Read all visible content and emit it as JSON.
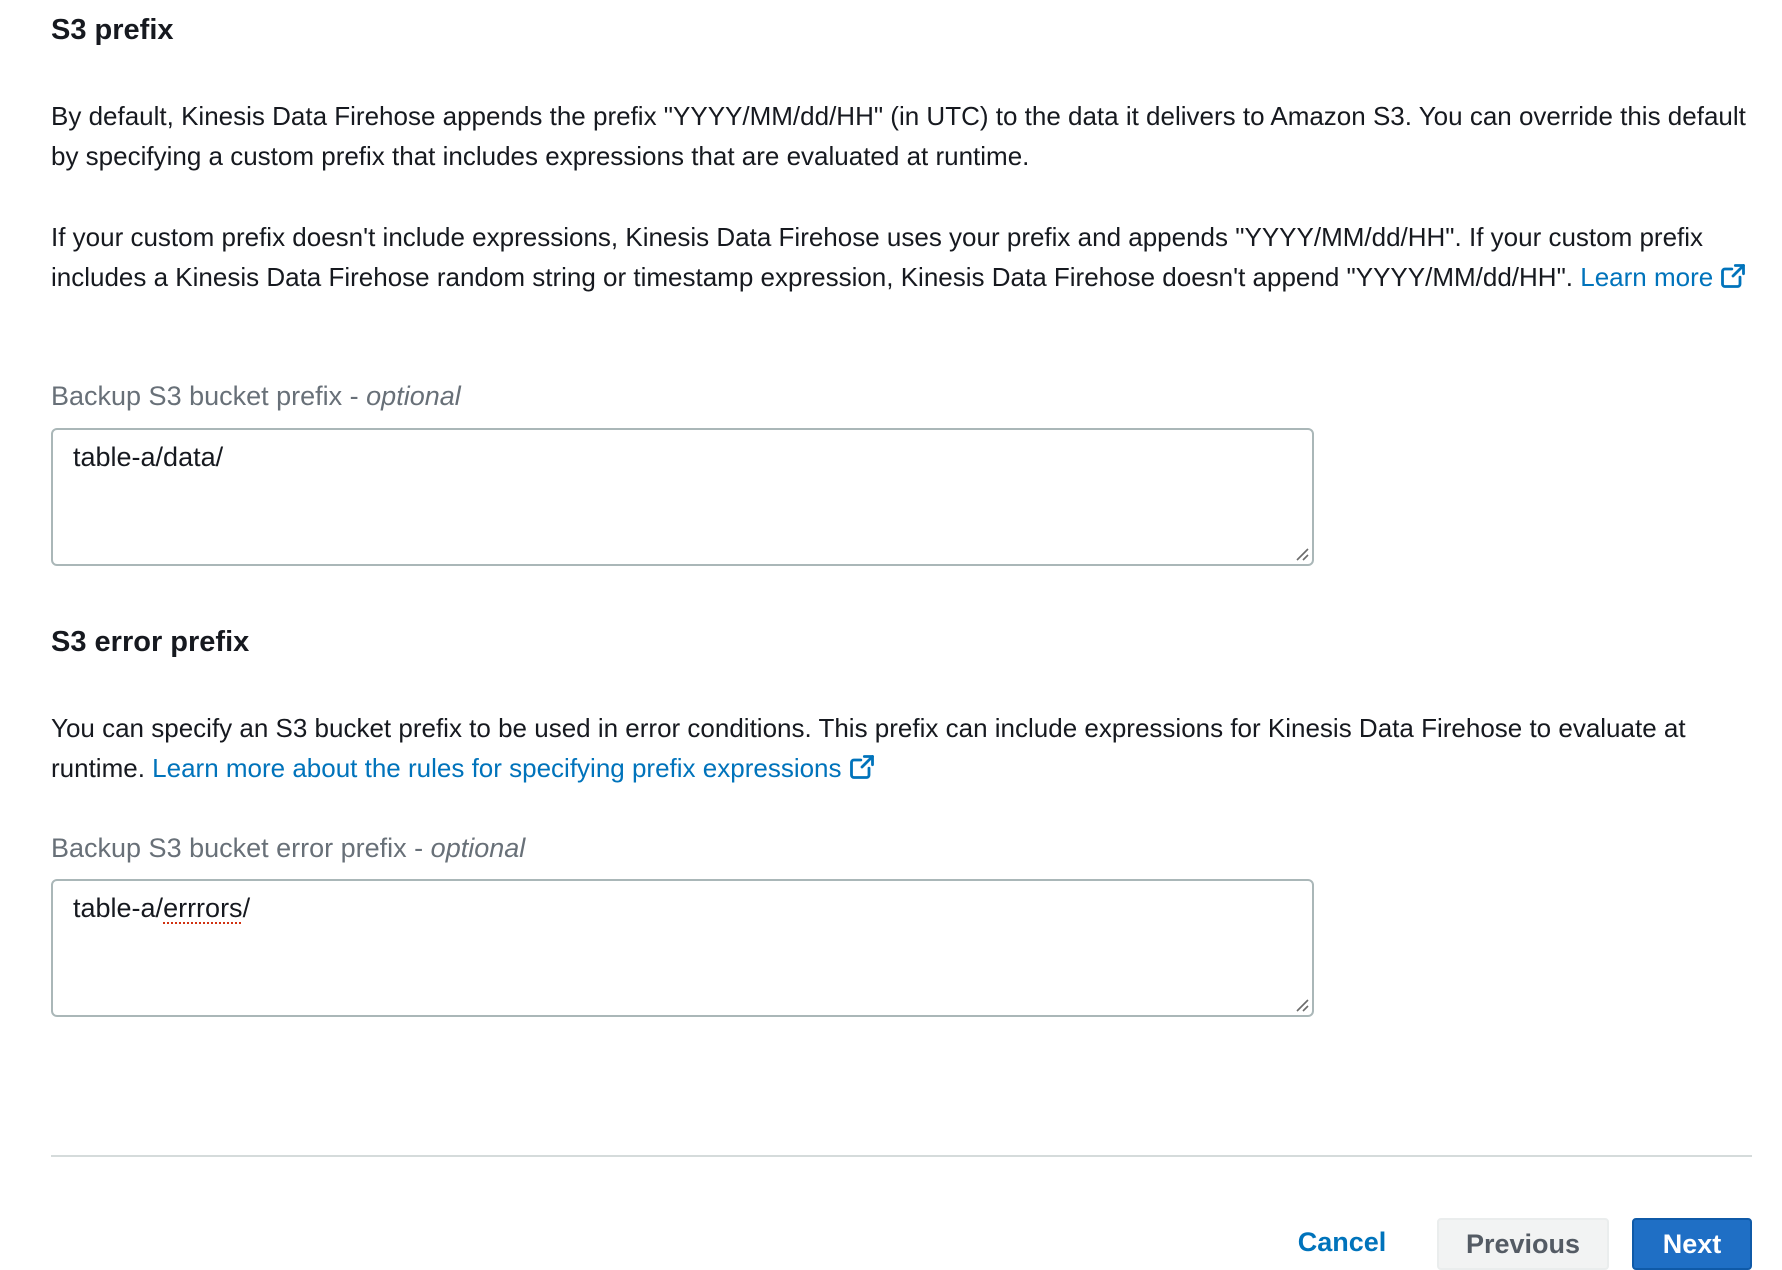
{
  "s3_prefix": {
    "title": "S3 prefix",
    "desc1": "By default, Kinesis Data Firehose appends the prefix \"YYYY/MM/dd/HH\" (in UTC) to the data it delivers to Amazon S3. You can override this default by specifying a custom prefix that includes expressions that are evaluated at runtime.",
    "desc2": "If your custom prefix doesn't include expressions, Kinesis Data Firehose uses your prefix and appends \"YYYY/MM/dd/HH\". If your custom prefix includes a Kinesis Data Firehose random string or timestamp expression, Kinesis Data Firehose doesn't append \"YYYY/MM/dd/HH\".",
    "link_text": "Learn more",
    "field_label": "Backup S3 bucket prefix - ",
    "field_optional": "optional",
    "field_value": "table-a/data/"
  },
  "s3_error_prefix": {
    "title": "S3 error prefix",
    "desc": "You can specify an S3 bucket prefix to be used in error conditions. This prefix can include expressions for Kinesis Data Firehose to evaluate at runtime.",
    "link_text": "Learn more about the rules for specifying prefix expressions",
    "field_label": "Backup S3 bucket error prefix - ",
    "field_optional": "optional",
    "field_value_prefix": "table-a/",
    "field_value_misspelled": "errrors",
    "field_value_suffix": "/"
  },
  "footer": {
    "cancel_label": "Cancel",
    "previous_label": "Previous",
    "next_label": "Next"
  },
  "icons": {
    "external_link": "external-link-icon",
    "resize_handle": "resize-handle-icon"
  },
  "colors": {
    "link": "#0073bb",
    "primary_button": "#1f6fc5",
    "text": "#16191f",
    "label": "#687078"
  }
}
